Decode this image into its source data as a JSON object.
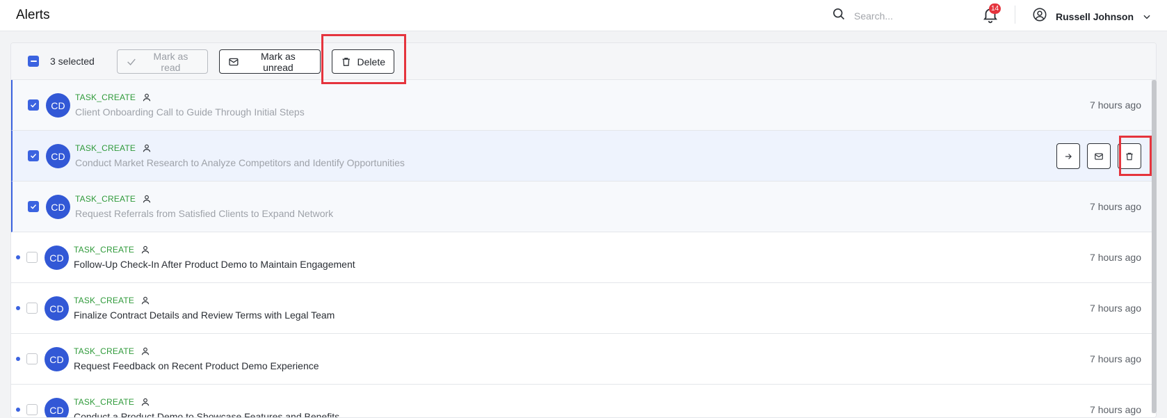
{
  "header": {
    "title": "Alerts",
    "search_placeholder": "Search...",
    "notification_count": "14",
    "user_name": "Russell Johnson"
  },
  "bulk": {
    "selected_text": "3 selected",
    "mark_read_label": "Mark as read",
    "mark_unread_label": "Mark as unread",
    "delete_label": "Delete"
  },
  "alerts": [
    {
      "initials": "CD",
      "type": "TASK_CREATE",
      "title": "Client Onboarding Call to Guide Through Initial Steps",
      "time": "7 hours ago",
      "selected": true,
      "unread": false
    },
    {
      "initials": "CD",
      "type": "TASK_CREATE",
      "title": "Conduct Market Research to Analyze Competitors and Identify Opportunities",
      "time": "",
      "selected": true,
      "unread": false
    },
    {
      "initials": "CD",
      "type": "TASK_CREATE",
      "title": "Request Referrals from Satisfied Clients to Expand Network",
      "time": "7 hours ago",
      "selected": true,
      "unread": false
    },
    {
      "initials": "CD",
      "type": "TASK_CREATE",
      "title": "Follow-Up Check-In After Product Demo to Maintain Engagement",
      "time": "7 hours ago",
      "selected": false,
      "unread": true
    },
    {
      "initials": "CD",
      "type": "TASK_CREATE",
      "title": "Finalize Contract Details and Review Terms with Legal Team",
      "time": "7 hours ago",
      "selected": false,
      "unread": true
    },
    {
      "initials": "CD",
      "type": "TASK_CREATE",
      "title": "Request Feedback on Recent Product Demo Experience",
      "time": "7 hours ago",
      "selected": false,
      "unread": true
    },
    {
      "initials": "CD",
      "type": "TASK_CREATE",
      "title": "Conduct a Product Demo to Showcase Features and Benefits",
      "time": "7 hours ago",
      "selected": false,
      "unread": true
    }
  ],
  "colors": {
    "accent": "#3b63e0",
    "type_label": "#2f9a3a",
    "highlight": "#e5343d"
  }
}
